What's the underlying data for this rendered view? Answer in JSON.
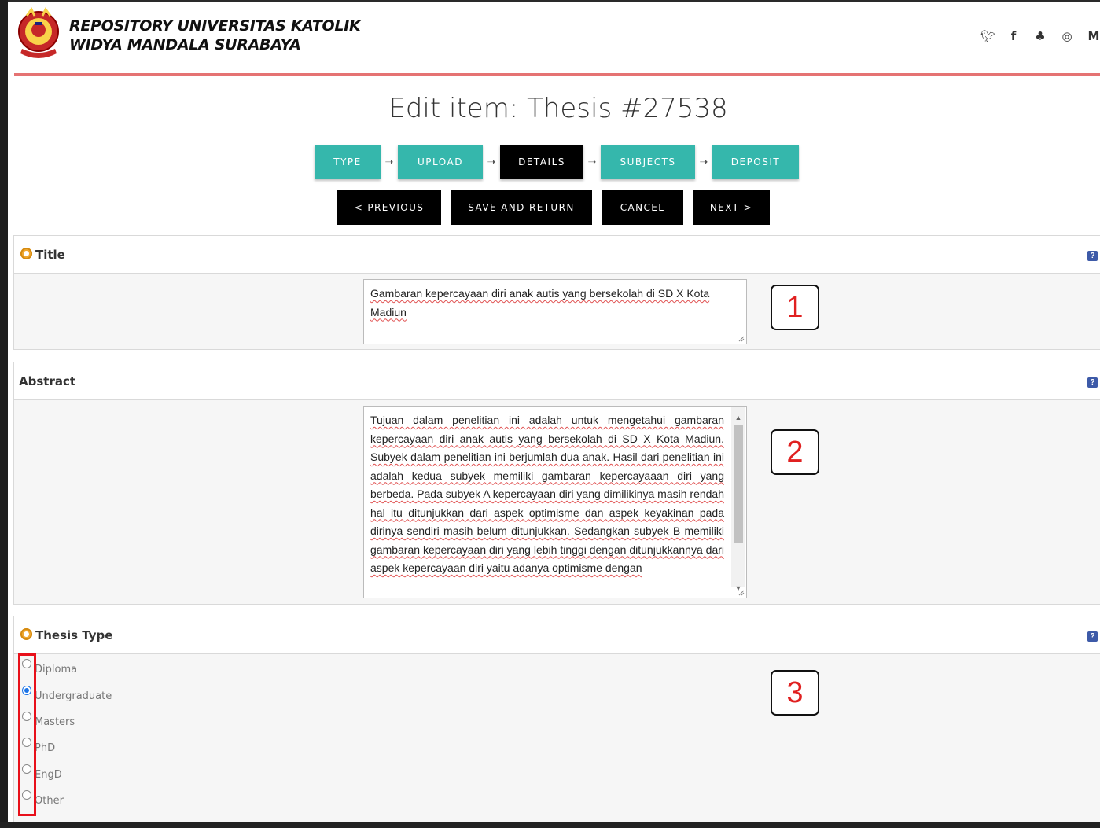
{
  "header": {
    "brand_line1": "REPOSITORY UNIVERSITAS KATOLIK",
    "brand_line2": "WIDYA MANDALA SURABAYA",
    "social": [
      "twitter-icon",
      "facebook-icon",
      "snapchat-icon",
      "instagram-icon",
      "medium-icon"
    ]
  },
  "page_title": "Edit item: Thesis #27538",
  "steps": [
    {
      "label": "TYPE",
      "active": false
    },
    {
      "label": "UPLOAD",
      "active": false
    },
    {
      "label": "DETAILS",
      "active": true
    },
    {
      "label": "SUBJECTS",
      "active": false
    },
    {
      "label": "DEPOSIT",
      "active": false
    }
  ],
  "actions": {
    "previous": "< PREVIOUS",
    "save_return": "SAVE AND RETURN",
    "cancel": "CANCEL",
    "next": "NEXT >"
  },
  "title_field": {
    "label": "Title",
    "value": "Gambaran kepercayaan diri anak autis yang bersekolah di SD X Kota Madiun"
  },
  "abstract_field": {
    "label": "Abstract",
    "value": "Tujuan dalam penelitian ini adalah untuk mengetahui gambaran kepercayaan diri anak autis yang bersekolah di SD X Kota Madiun. Subyek dalam penelitian ini berjumlah dua anak. Hasil dari penelitian ini adalah kedua subyek memiliki gambaran kepercayaaan diri yang berbeda. Pada subyek A kepercayaan diri yang dimilikinya masih rendah hal itu ditunjukkan dari aspek optimisme dan aspek keyakinan pada dirinya sendiri masih belum ditunjukkan. Sedangkan subyek B memiliki gambaran kepercayaan diri yang lebih tinggi dengan ditunjukkannya dari aspek kepercayaan diri yaitu adanya optimisme dengan"
  },
  "thesis_type": {
    "label": "Thesis Type",
    "options": [
      "Diploma",
      "Undergraduate",
      "Masters",
      "PhD",
      "EngD",
      "Other"
    ],
    "selected": "Undergraduate"
  },
  "callouts": [
    "1",
    "2",
    "3"
  ],
  "help_icon": "?"
}
